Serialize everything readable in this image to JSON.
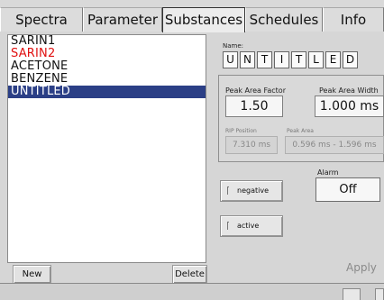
{
  "tabs": [
    {
      "label": "Spectra"
    },
    {
      "label": "Parameter"
    },
    {
      "label": "Substances",
      "active": true
    },
    {
      "label": "Schedules"
    },
    {
      "label": "Info"
    }
  ],
  "substances": {
    "items": [
      {
        "label": "SARIN1",
        "color": "#111111"
      },
      {
        "label": "SARIN2",
        "color": "#e01010"
      },
      {
        "label": "ACETONE",
        "color": "#111111"
      },
      {
        "label": "BENZENE",
        "color": "#111111"
      },
      {
        "label": "UNTITLED",
        "color": "#ffffff",
        "selected": true
      }
    ],
    "new_label": "New",
    "delete_label": "Delete"
  },
  "details": {
    "name_label": "Name:",
    "name_chars": [
      "U",
      "N",
      "T",
      "I",
      "T",
      "L",
      "E",
      "D"
    ],
    "peak_area_factor_label": "Peak Area Factor",
    "peak_area_factor_value": "1.50",
    "peak_area_width_label": "Peak Area Width",
    "peak_area_width_value": "1.000 ms",
    "rip_position_label": "RIP Position",
    "rip_position_value": "7.310 ms",
    "peak_area_label": "Peak Area",
    "peak_area_value": "0.596 ms - 1.596 ms",
    "negative_label": "negative",
    "active_label": "active",
    "alarm_label": "Alarm",
    "alarm_value": "Off",
    "apply_label": "Apply"
  },
  "colors": {
    "selection": "#2b3f86",
    "warning_text": "#e01010"
  }
}
